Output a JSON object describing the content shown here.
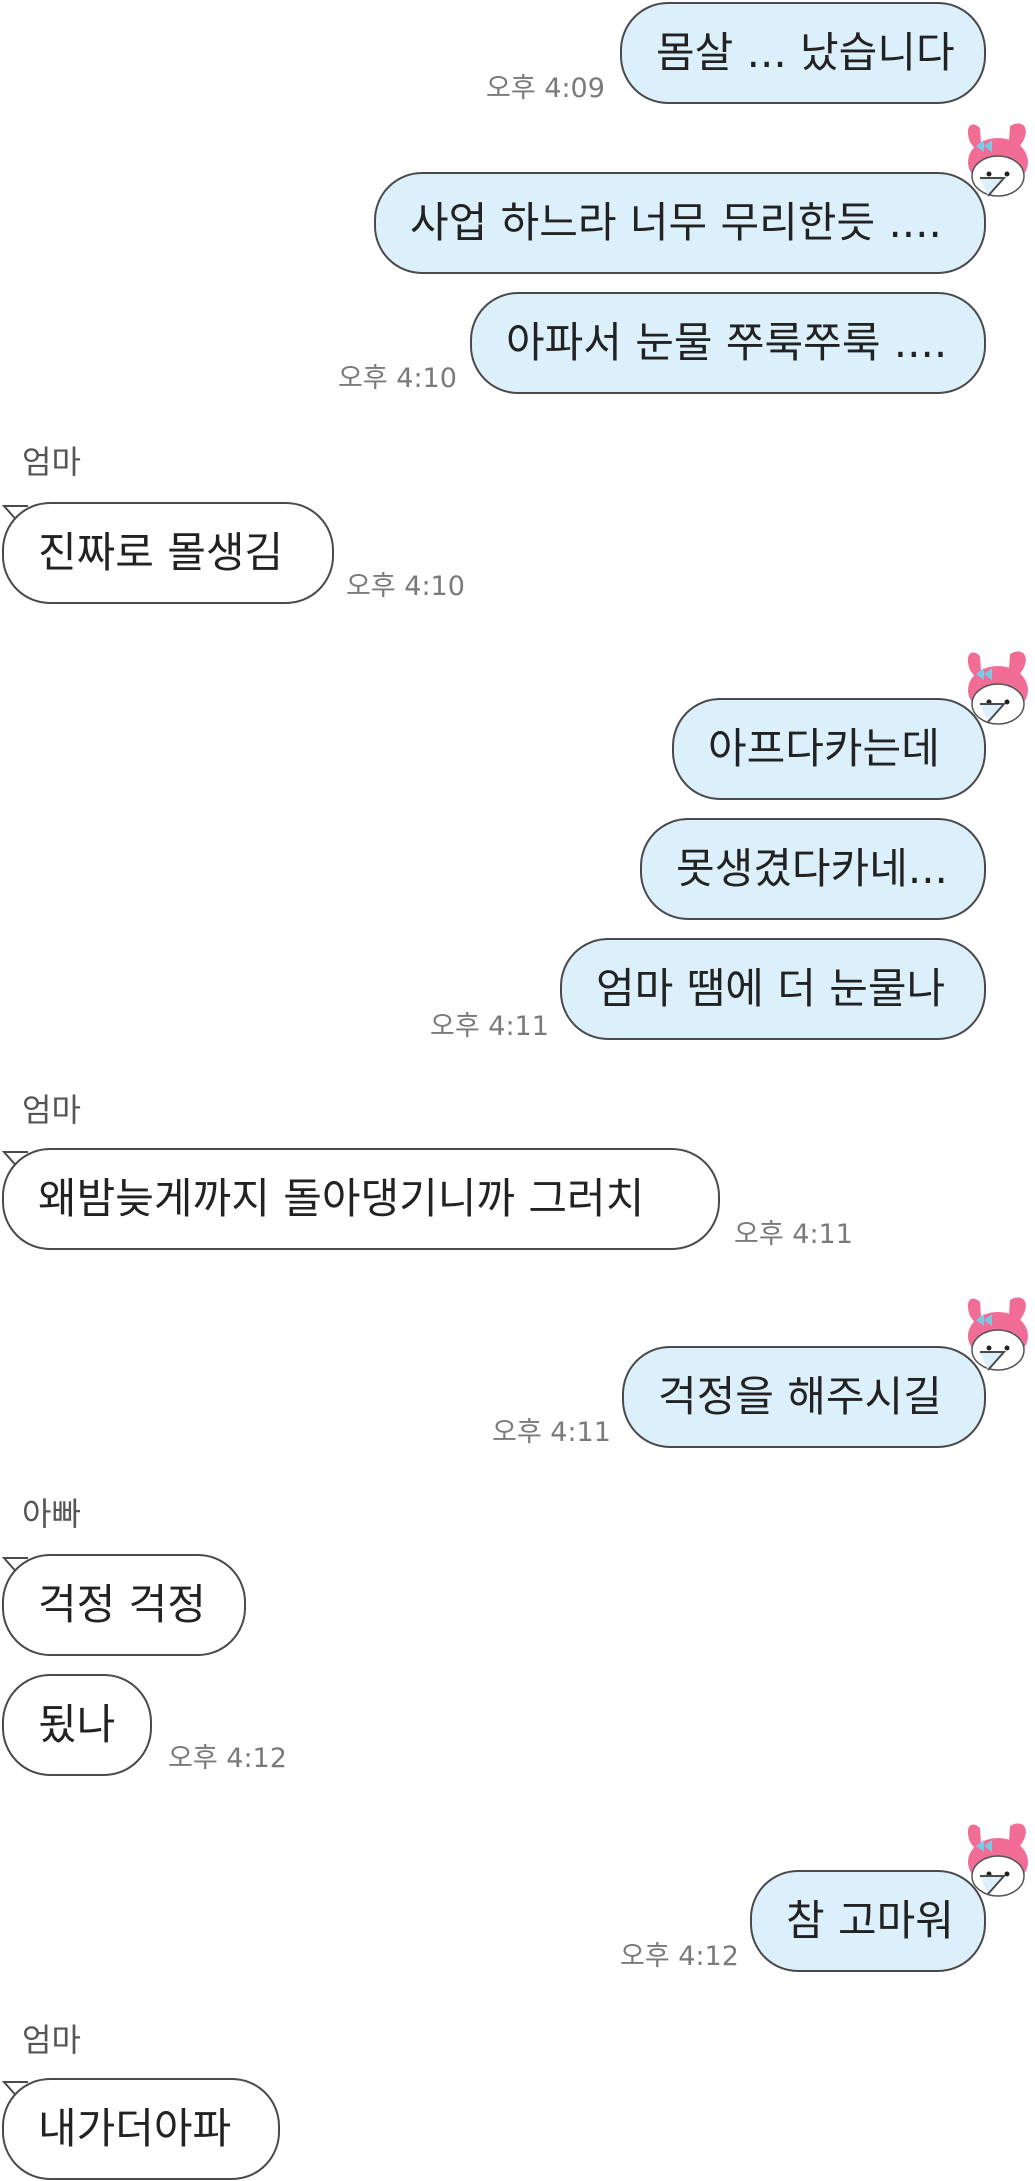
{
  "conversation": {
    "groups": [
      {
        "side": "out",
        "time": "오후 4:09",
        "messages": [
          "몸살 ... 났습니다"
        ]
      },
      {
        "side": "out",
        "time": "오후 4:10",
        "messages": [
          "사업 하느라 너무 무리한듯 ....",
          "아파서 눈물 쭈룩쭈룩 ...."
        ]
      },
      {
        "side": "in",
        "sender": "엄마",
        "time": "오후 4:10",
        "messages": [
          "진짜로 몰생김"
        ]
      },
      {
        "side": "out",
        "time": "오후 4:11",
        "messages": [
          "아프다카는데",
          "못생겼다카네...",
          "엄마 땜에 더 눈물나"
        ]
      },
      {
        "side": "in",
        "sender": "엄마",
        "time": "오후 4:11",
        "messages": [
          "왜밤늦게까지 돌아댕기니까 그러치"
        ]
      },
      {
        "side": "out",
        "time": "오후 4:11",
        "messages": [
          "걱정을 해주시길"
        ]
      },
      {
        "side": "in",
        "sender": "아빠",
        "time": "오후 4:12",
        "messages": [
          "걱정 걱정",
          "됬나"
        ]
      },
      {
        "side": "out",
        "time": "오후 4:12",
        "messages": [
          "참 고마워"
        ]
      },
      {
        "side": "in",
        "sender": "엄마",
        "messages": [
          "내가더아파"
        ]
      }
    ]
  },
  "colors": {
    "outgoing_bubble": "#dcf0fc",
    "incoming_bubble": "#ffffff",
    "bubble_border": "#4a4a4a",
    "timestamp": "#7a7a7a",
    "sender_name": "#555555"
  },
  "avatar_icon": "my-melody-sticker-icon"
}
